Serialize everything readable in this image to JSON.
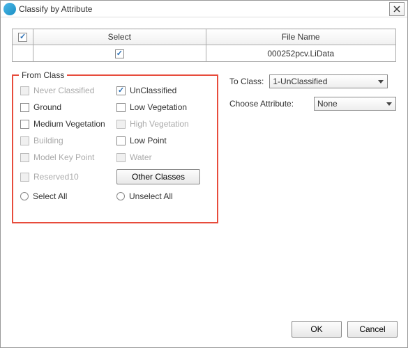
{
  "title": "Classify by Attribute",
  "table": {
    "headers": {
      "select": "Select",
      "filename": "File Name"
    },
    "rows": [
      {
        "checked": true,
        "filename": "000252pcv.LiData"
      }
    ]
  },
  "from_class": {
    "legend": "From Class",
    "items": [
      {
        "label": "Never Classified",
        "checked": false,
        "disabled": true
      },
      {
        "label": "UnClassified",
        "checked": true,
        "disabled": false
      },
      {
        "label": "Ground",
        "checked": false,
        "disabled": false
      },
      {
        "label": "Low Vegetation",
        "checked": false,
        "disabled": false
      },
      {
        "label": "Medium Vegetation",
        "checked": false,
        "disabled": false
      },
      {
        "label": "High Vegetation",
        "checked": false,
        "disabled": true
      },
      {
        "label": "Building",
        "checked": false,
        "disabled": true
      },
      {
        "label": "Low Point",
        "checked": false,
        "disabled": false
      },
      {
        "label": "Model Key Point",
        "checked": false,
        "disabled": true
      },
      {
        "label": "Water",
        "checked": false,
        "disabled": true
      },
      {
        "label": "Reserved10",
        "checked": false,
        "disabled": true
      }
    ],
    "other_classes": "Other Classes",
    "select_all": "Select All",
    "unselect_all": "Unselect All"
  },
  "to_class": {
    "label": "To Class:",
    "value": "1-UnClassified"
  },
  "choose_attr": {
    "label": "Choose Attribute:",
    "value": "None"
  },
  "buttons": {
    "ok": "OK",
    "cancel": "Cancel"
  }
}
